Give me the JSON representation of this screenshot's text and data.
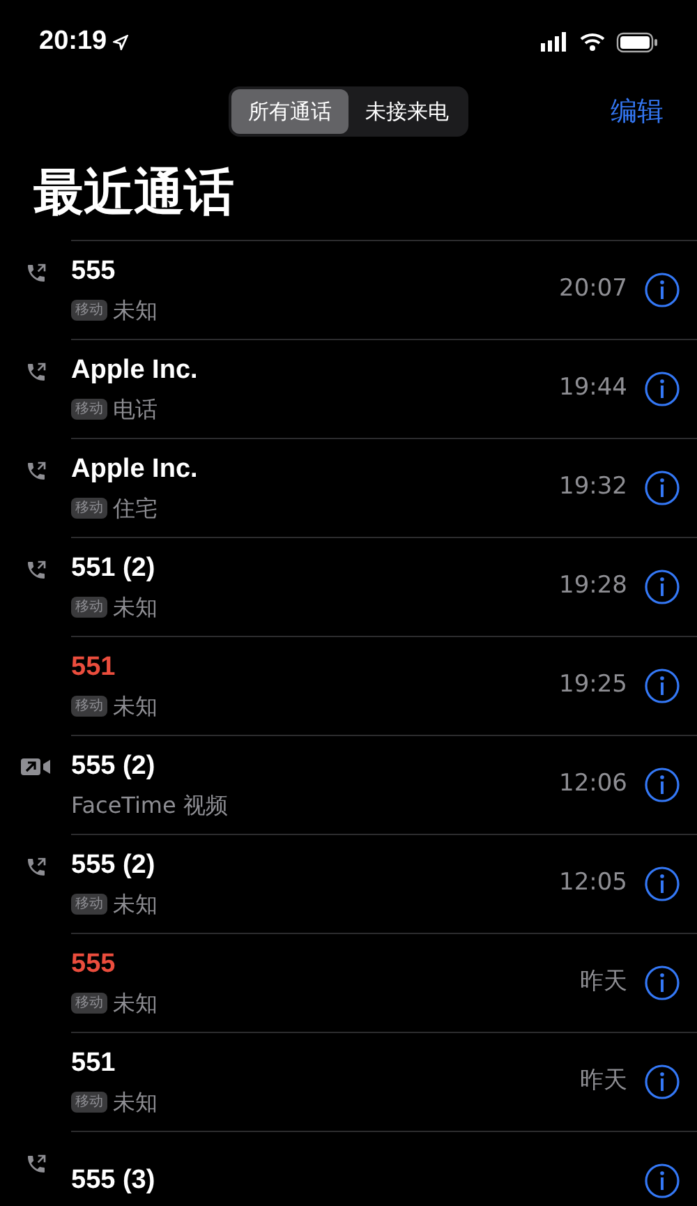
{
  "status_bar": {
    "time": "20:19"
  },
  "segments": [
    {
      "label": "所有通话",
      "selected": true
    },
    {
      "label": "未接来电",
      "selected": false
    }
  ],
  "edit_button": "编辑",
  "title": "最近通话",
  "calls": [
    {
      "name": "555",
      "missed": false,
      "kind": "outgoing",
      "badge": "移动",
      "detail": "未知",
      "time": "20:07"
    },
    {
      "name": "Apple Inc.",
      "missed": false,
      "kind": "outgoing",
      "badge": "移动",
      "detail": "电话",
      "time": "19:44"
    },
    {
      "name": "Apple Inc.",
      "missed": false,
      "kind": "outgoing",
      "badge": "移动",
      "detail": "住宅",
      "time": "19:32"
    },
    {
      "name": "551 (2)",
      "missed": false,
      "kind": "outgoing",
      "badge": "移动",
      "detail": "未知",
      "time": "19:28"
    },
    {
      "name": "551",
      "missed": true,
      "kind": "incoming",
      "badge": "移动",
      "detail": "未知",
      "time": "19:25"
    },
    {
      "name": "555 (2)",
      "missed": false,
      "kind": "video",
      "detail": "FaceTime 视频",
      "time": "12:06"
    },
    {
      "name": "555 (2)",
      "missed": false,
      "kind": "outgoing",
      "badge": "移动",
      "detail": "未知",
      "time": "12:05"
    },
    {
      "name": "555",
      "missed": true,
      "kind": "incoming",
      "badge": "移动",
      "detail": "未知",
      "time": "昨天"
    },
    {
      "name": "551",
      "missed": false,
      "kind": "incoming",
      "badge": "移动",
      "detail": "未知",
      "time": "昨天"
    },
    {
      "name": "555 (3)",
      "missed": false,
      "kind": "outgoing"
    }
  ]
}
